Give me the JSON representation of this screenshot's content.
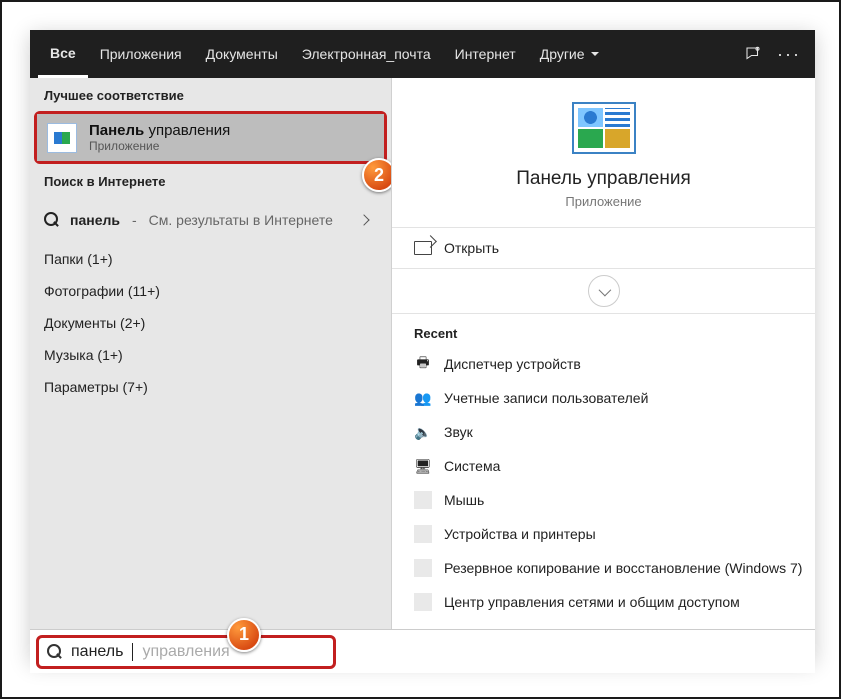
{
  "tabs": {
    "all": "Все",
    "apps": "Приложения",
    "docs": "Документы",
    "email": "Электронная_почта",
    "internet": "Интернет",
    "other": "Другие"
  },
  "left": {
    "best_match_label": "Лучшее соответствие",
    "hit_title_bold": "Панель",
    "hit_title_rest": " управления",
    "hit_sub": "Приложение",
    "web_label": "Поиск в Интернете",
    "web_term": "панель",
    "web_sep": "-",
    "web_hint": "См. результаты в Интернете",
    "cats": {
      "folders": "Папки (1+)",
      "photos": "Фотографии (11+)",
      "docs": "Документы (2+)",
      "music": "Музыка (1+)",
      "params": "Параметры (7+)"
    }
  },
  "right": {
    "hero_title": "Панель управления",
    "hero_sub": "Приложение",
    "open": "Открыть",
    "recent_label": "Recent",
    "recent": {
      "r1": "Диспетчер устройств",
      "r2": "Учетные записи пользователей",
      "r3": "Звук",
      "r4": "Система",
      "r5": "Мышь",
      "r6": "Устройства и принтеры",
      "r7": "Резервное копирование и восстановление (Windows 7)",
      "r8": "Центр управления сетями и общим доступом"
    }
  },
  "search": {
    "typed": "панель",
    "ghost": " управления"
  },
  "badges": {
    "b1": "1",
    "b2": "2"
  }
}
